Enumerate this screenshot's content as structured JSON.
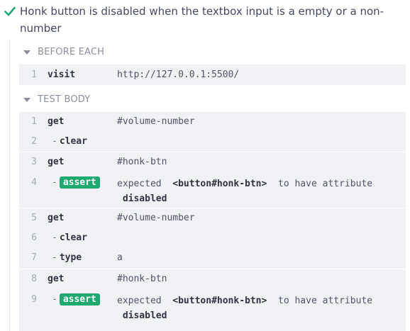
{
  "test": {
    "title": "Honk button is disabled when the textbox input is a empty or a non-number"
  },
  "before_each": {
    "label": "BEFORE EACH",
    "commands": [
      {
        "num": "1",
        "name": "visit",
        "message": "http://127.0.0.1:5500/"
      }
    ]
  },
  "test_body": {
    "label": "TEST BODY",
    "commands": [
      {
        "num": "1",
        "name": "get",
        "message": "#volume-number"
      },
      {
        "num": "2",
        "name": "clear",
        "message": ""
      },
      {
        "num": "3",
        "name": "get",
        "message": "#honk-btn"
      },
      {
        "num": "4",
        "name": "assert",
        "msg_pre": "expected",
        "msg_el": "<button#honk-btn>",
        "msg_post": "to have attribute",
        "msg_attr": "disabled"
      },
      {
        "num": "5",
        "name": "get",
        "message": "#volume-number"
      },
      {
        "num": "6",
        "name": "clear",
        "message": ""
      },
      {
        "num": "7",
        "name": "type",
        "message": "a"
      },
      {
        "num": "8",
        "name": "get",
        "message": "#honk-btn"
      },
      {
        "num": "9",
        "name": "assert",
        "msg_pre": "expected",
        "msg_el": "<button#honk-btn>",
        "msg_post": "to have attribute",
        "msg_attr": "disabled"
      }
    ]
  },
  "colors": {
    "pass": "#1fa971",
    "command_bg": "#f0f2f5",
    "text": "#434861"
  }
}
